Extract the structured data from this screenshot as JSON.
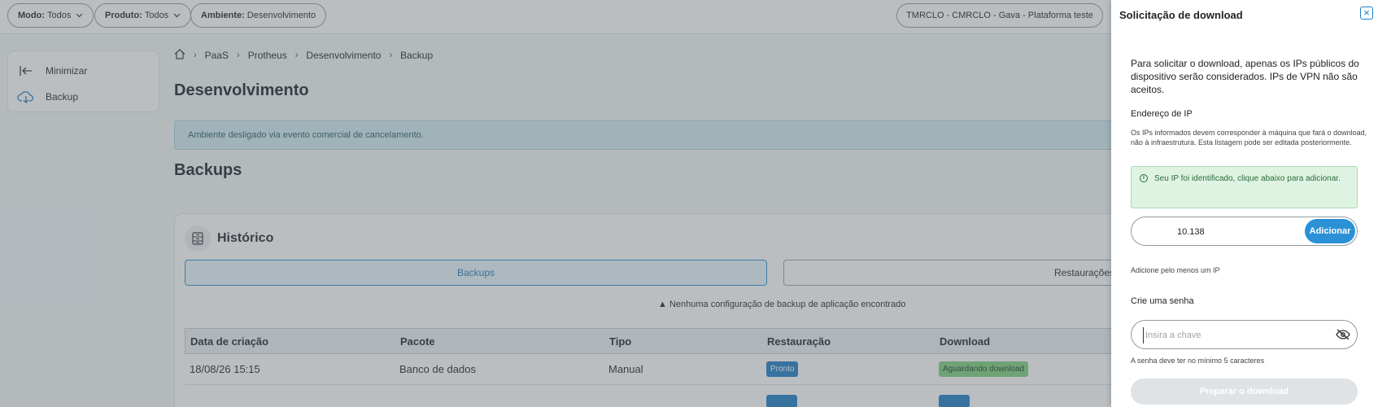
{
  "topbar": {
    "mode": {
      "label": "Modo:",
      "value": "Todos"
    },
    "product": {
      "label": "Produto:",
      "value": "Todos"
    },
    "environment": {
      "label": "Ambiente:",
      "value": "Desenvolvimento"
    },
    "tenant": "TMRCLO - CMRCLO - Gava - Plataforma teste"
  },
  "sidebar": {
    "items": [
      {
        "label": "Minimizar",
        "icon": "collapse-left-icon"
      },
      {
        "label": "Backup",
        "icon": "cloud-download-icon"
      }
    ]
  },
  "breadcrumb": {
    "home_icon": "home-icon",
    "items": [
      "PaaS",
      "Protheus",
      "Desenvolvimento",
      "Backup"
    ]
  },
  "main": {
    "title": "Desenvolvimento",
    "alert": "Ambiente desligado via evento comercial de cancelamento.",
    "section_title": "Backups",
    "card": {
      "title": "Histórico",
      "tabs": [
        {
          "label": "Backups"
        },
        {
          "label": "Restaurações"
        }
      ],
      "warning": "Nenhuma configuração de backup de aplicação encontrado",
      "table": {
        "headers": [
          "Data de criação",
          "Pacote",
          "Tipo",
          "Restauração",
          "Download"
        ],
        "rows": [
          {
            "date": "18/08/26 15:15",
            "package": "Banco de dados",
            "type": "Manual",
            "restore": "Pronto",
            "download": "Aguardando download"
          }
        ]
      }
    }
  },
  "panel": {
    "title": "Solicitação de download",
    "description": "Para solicitar o download, apenas os IPs públicos do dispositivo serão considerados. IPs de VPN não são aceitos.",
    "ip_label": "Endereço de IP",
    "ip_help": "Os IPs informados devem corresponder à máquina que fará o download, não à infraestrutura. Esta listagem pode ser editada posteriormente.",
    "ip_detected": "Seu IP foi identificado, clique abaixo para adicionar.",
    "ip_value": "10.138",
    "add_label": "Adicionar",
    "ip_hint": "Adicione pelo menos um IP",
    "password_section": "Crie uma senha",
    "password_placeholder": "Insira a chave",
    "password_hint": "A senha deve ter no mínimo 5 caracteres",
    "prepare_label": "Preparar o download"
  },
  "colors": {
    "accent": "#2b91d6",
    "success_bg": "#dff3e3",
    "info_bg": "#d3ecf2"
  }
}
